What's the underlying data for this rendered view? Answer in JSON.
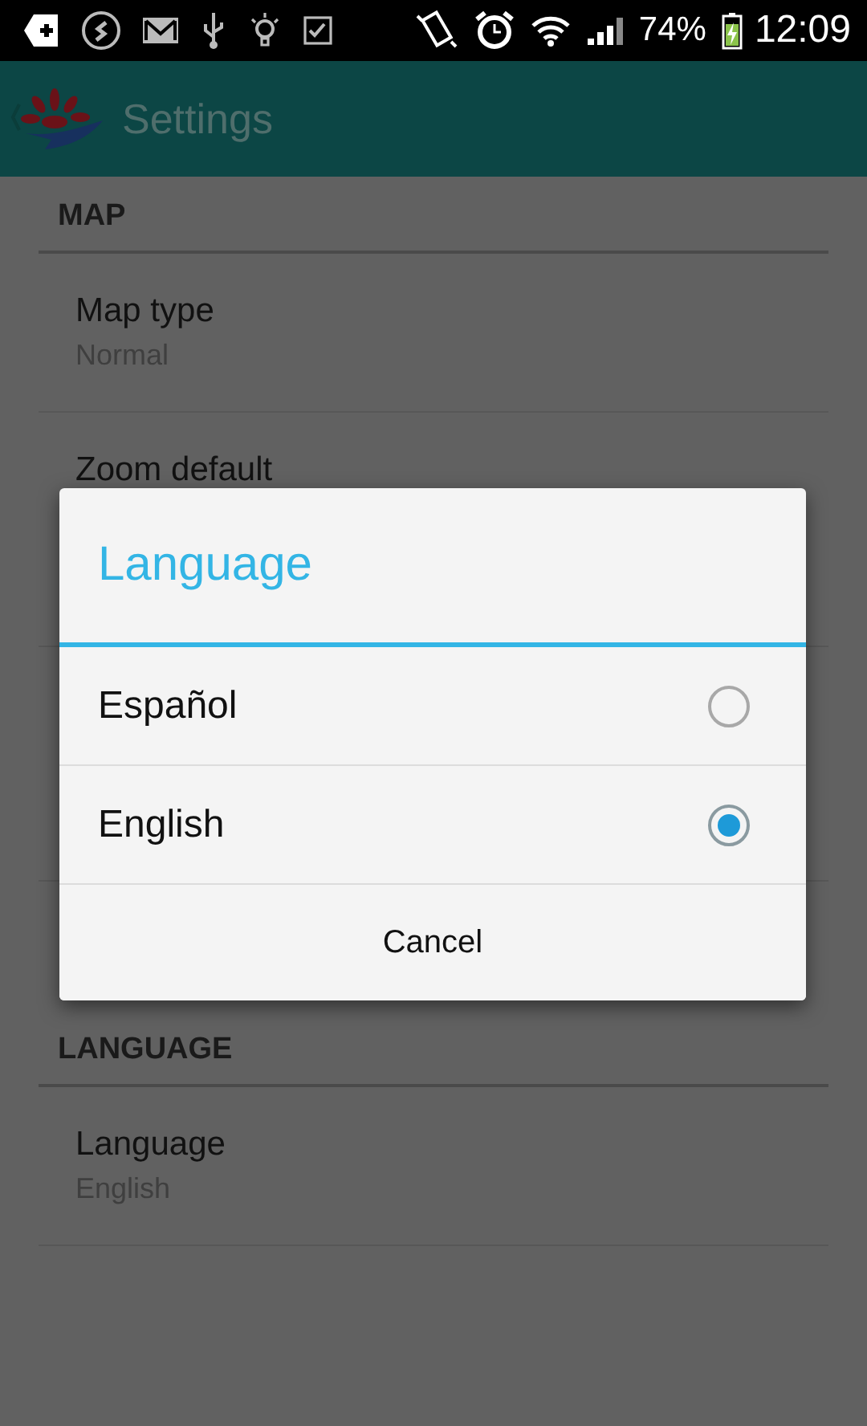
{
  "status_bar": {
    "battery": "74%",
    "time": "12:09"
  },
  "app_bar": {
    "title": "Settings"
  },
  "sections": [
    {
      "header": "MAP",
      "items": [
        {
          "title": "Map type",
          "summary": "Normal"
        },
        {
          "title": "Zoom default"
        }
      ]
    },
    {
      "header": "LANGUAGE",
      "items": [
        {
          "title": "Language",
          "summary": "English"
        }
      ]
    }
  ],
  "dialog": {
    "title": "Language",
    "options": [
      {
        "label": "Español",
        "selected": false
      },
      {
        "label": "English",
        "selected": true
      }
    ],
    "button": "Cancel"
  }
}
